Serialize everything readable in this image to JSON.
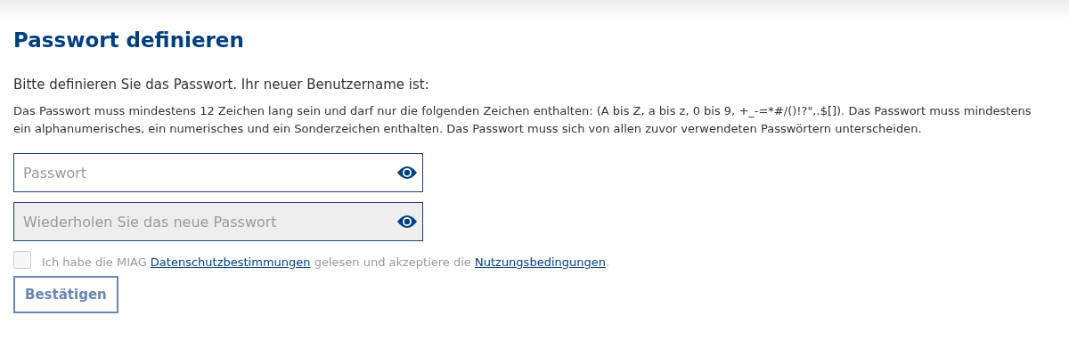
{
  "title": "Passwort definieren",
  "intro": "Bitte definieren Sie das Passwort. Ihr neuer Benutzername ist:",
  "rules": "Das Passwort muss mindestens 12 Zeichen lang sein und darf nur die folgenden Zeichen enthalten: (A bis Z, a bis z, 0 bis 9, +_-=*#/()!?\",.$[]). Das Passwort muss mindestens ein alphanumerisches, ein numerisches und ein Sonderzeichen enthalten. Das Passwort muss sich von allen zuvor verwendeten Passwörtern unterscheiden.",
  "fields": [
    {
      "placeholder": "Passwort",
      "disabled": false
    },
    {
      "placeholder": "Wiederholen Sie das neue Passwort",
      "disabled": true
    }
  ],
  "consent": {
    "checked": false,
    "parts": [
      {
        "kind": "text",
        "text": "Ich habe die MIAG "
      },
      {
        "kind": "link",
        "text": "Datenschutzbestimmungen"
      },
      {
        "kind": "text",
        "text": " gelesen und akzeptiere die "
      },
      {
        "kind": "link",
        "text": "Nutzungsbedingungen"
      },
      {
        "kind": "text",
        "text": "."
      }
    ]
  },
  "submit": {
    "label": "Bestätigen",
    "disabled": true
  }
}
